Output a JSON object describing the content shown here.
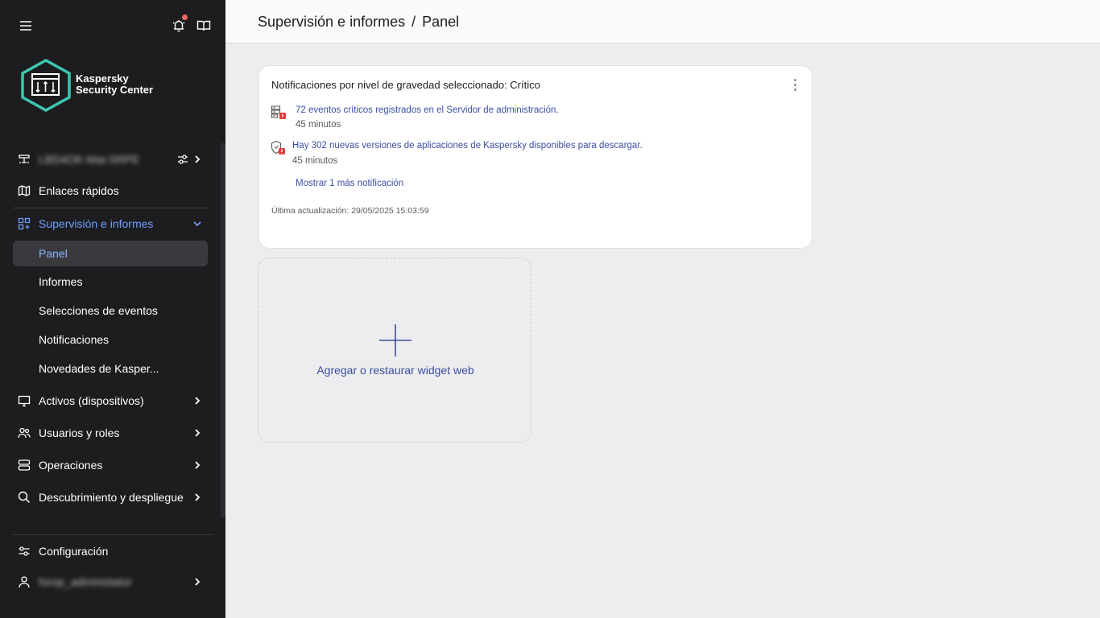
{
  "header": {
    "breadcrumb_section": "Supervisión e informes",
    "breadcrumb_separator": "/",
    "breadcrumb_page": "Panel"
  },
  "sidebar": {
    "logo_line1": "Kaspersky",
    "logo_line2": "Security Center",
    "server_name": "LBD4OK-Mai-SRPE",
    "items": [
      {
        "label": "Enlaces rápidos"
      },
      {
        "label": "Supervisión e informes"
      },
      {
        "label": "Panel"
      },
      {
        "label": "Informes"
      },
      {
        "label": "Selecciones de eventos"
      },
      {
        "label": "Notificaciones"
      },
      {
        "label": "Novedades de Kasper..."
      },
      {
        "label": "Activos (dispositivos)"
      },
      {
        "label": "Usuarios y roles"
      },
      {
        "label": "Operaciones"
      },
      {
        "label": "Descubrimiento y despliegue"
      },
      {
        "label": "Configuración"
      }
    ],
    "user_name": "forop_administator",
    "colors": {
      "background": "#1d1d1f",
      "active": "#6f9dff",
      "selected_bg": "#3a3a3e"
    }
  },
  "widget": {
    "title": "Notificaciones por nivel de gravedad seleccionado: Crítico",
    "notifications": [
      {
        "text": "72 eventos críticos registrados en el Servidor de administración.",
        "time": "45 minutos",
        "icon": "server-alert-icon"
      },
      {
        "text": "Hay 302 nuevas versiones de aplicaciones de Kaspersky disponibles para descargar.",
        "time": "45 minutos",
        "icon": "shield-alert-icon"
      }
    ],
    "more_link": "Mostrar 1 más notificación",
    "last_update": "Última actualización: 29/05/2025 15:03:59"
  },
  "add_widget": {
    "label": "Agregar o restaurar widget web"
  }
}
